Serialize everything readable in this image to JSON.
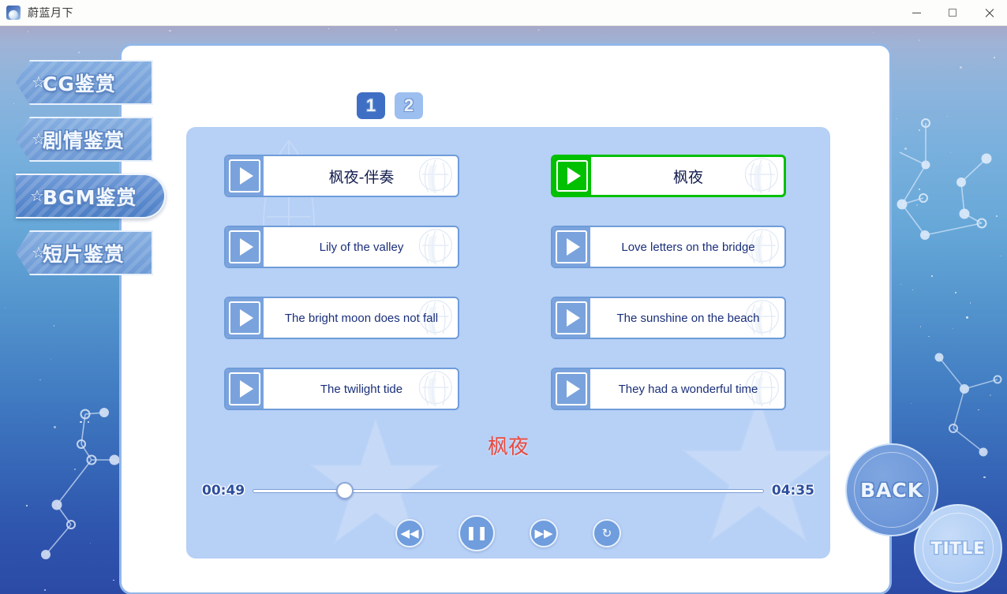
{
  "window": {
    "title": "蔚蓝月下",
    "icon": "app-icon",
    "controls": {
      "minimize": "minimize-icon",
      "maximize": "maximize-icon",
      "close": "close-icon"
    }
  },
  "sidebar": {
    "items": [
      {
        "label": "CG鉴赏",
        "star": "☆",
        "active": false
      },
      {
        "label": "剧情鉴赏",
        "star": "☆",
        "active": false
      },
      {
        "label": "BGM鉴赏",
        "star": "☆",
        "active": true
      },
      {
        "label": "短片鉴赏",
        "star": "☆",
        "active": false
      }
    ]
  },
  "pagination": {
    "tabs": [
      {
        "label": "1",
        "active": true
      },
      {
        "label": "2",
        "active": false
      }
    ]
  },
  "tracks": [
    {
      "title": "枫夜-伴奏",
      "cjk": true,
      "selected": false,
      "play_icon": "play-icon"
    },
    {
      "title": "枫夜",
      "cjk": true,
      "selected": true,
      "play_icon": "play-icon"
    },
    {
      "title": "Lily of the valley",
      "cjk": false,
      "selected": false,
      "play_icon": "play-icon"
    },
    {
      "title": "Love letters on the bridge",
      "cjk": false,
      "selected": false,
      "play_icon": "play-icon"
    },
    {
      "title": "The bright moon does not fall",
      "cjk": false,
      "selected": false,
      "play_icon": "play-icon"
    },
    {
      "title": "The sunshine on the beach",
      "cjk": false,
      "selected": false,
      "play_icon": "play-icon"
    },
    {
      "title": "The twilight tide",
      "cjk": false,
      "selected": false,
      "play_icon": "play-icon"
    },
    {
      "title": "They had a wonderful time",
      "cjk": false,
      "selected": false,
      "play_icon": "play-icon"
    }
  ],
  "player": {
    "now_playing": "枫夜",
    "time_current": "00:49",
    "time_total": "04:35",
    "progress_percent": 18,
    "controls": [
      {
        "name": "rewind-button",
        "glyph": "◀◀"
      },
      {
        "name": "pause-button",
        "glyph": "❚❚"
      },
      {
        "name": "forward-button",
        "glyph": "▶▶"
      },
      {
        "name": "repeat-button",
        "glyph": "↻"
      }
    ]
  },
  "nav_buttons": {
    "back": "BACK",
    "title": "TITLE"
  },
  "colors": {
    "accent_blue": "#6f9cd9",
    "selected_green": "#00c000",
    "now_playing_red": "#e8493f",
    "panel_bg": "#b6d0f6",
    "card_bg": "#ffffff",
    "active_tab": "#3f6fc4"
  }
}
